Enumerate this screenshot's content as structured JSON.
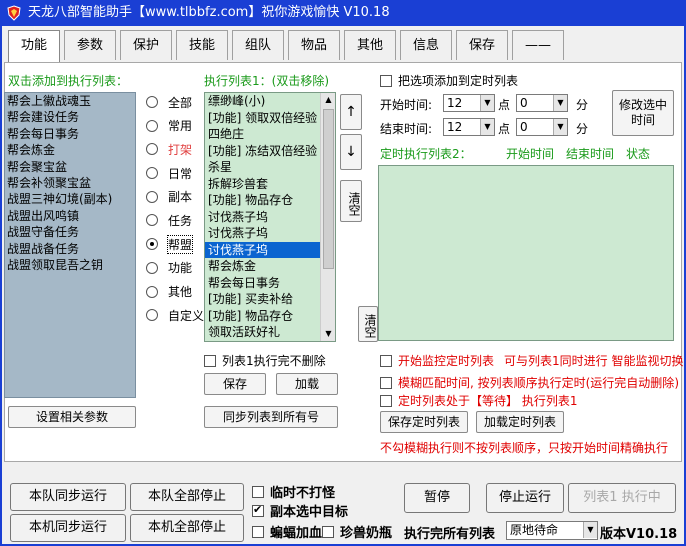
{
  "window": {
    "title": "天龙八部智能助手【www.tlbbfz.com】祝你游戏愉快 V10.18"
  },
  "tabs": [
    "功能",
    "参数",
    "保护",
    "技能",
    "组队",
    "物品",
    "其他",
    "信息",
    "保存",
    "——"
  ],
  "left_panel": {
    "header": "双击添加到执行列表：",
    "items": [
      "帮会上徽战魂玉",
      "帮会建设任务",
      "帮会每日事务",
      "帮会炼金",
      "帮会聚宝盆",
      "帮会补领聚宝盆",
      "战盟三神幻境(副本)",
      "战盟出风鸣镇",
      "战盟守备任务",
      "战盟战备任务",
      "战盟领取昆吾之钥"
    ],
    "settings_button": "设置相关参数"
  },
  "categories": {
    "items": [
      "全部",
      "常用",
      "打架",
      "日常",
      "副本",
      "任务",
      "帮盟",
      "功能",
      "其他",
      "自定义"
    ],
    "selected": "帮盟",
    "highlight": "打架"
  },
  "exec_list": {
    "header": "执行列表1：(双击移除)",
    "items": [
      "缥缈峰(小)",
      "[功能] 领取双倍经验",
      "四绝庄",
      "[功能] 冻结双倍经验",
      "杀星",
      "拆解珍兽套",
      "[功能] 物品存仓",
      "讨伐燕子坞",
      "讨伐燕子坞",
      "讨伐燕子坞",
      "帮会炼金",
      "帮会每日事务",
      "[功能] 买卖补给",
      "[功能] 物品存仓",
      "领取活跃好礼"
    ],
    "selected_index": 9,
    "up": "↑",
    "down": "↓",
    "clear": "清空",
    "no_delete_label": "列表1执行完不删除",
    "save": "保存",
    "load": "加载",
    "sync_all": "同步列表到所有号"
  },
  "timer": {
    "add_label": "把选项添加到定时列表",
    "start_label": "开始时间:",
    "end_label": "结束时间:",
    "start_hour": "12",
    "start_min": "0",
    "end_hour": "12",
    "end_min": "0",
    "hour_unit": "点",
    "min_unit": "分",
    "modify_button": "修改选中时间",
    "list_header": "定时执行列表2：",
    "col_start": "开始时间",
    "col_end": "结束时间",
    "col_status": "状态",
    "clear": "清空",
    "monitor_label": "开始监控定时列表",
    "monitor_note": "可与列表1同时进行 智能监视切换",
    "fuzzy_label": "模糊匹配时间, 按列表顺序执行定时(运行完自动删除)",
    "wait_label": "定时列表处于【等待】 执行列表1",
    "save": "保存定时列表",
    "load": "加载定时列表",
    "note": "不勾模糊执行则不按列表顺序，只按开始时间精确执行"
  },
  "bottom": {
    "team_sync_run": "本队同步运行",
    "team_stop_all": "本队全部停止",
    "local_sync_run": "本机同步运行",
    "local_stop_all": "本机全部停止",
    "no_fight": "临时不打怪",
    "copy_select": "副本选中目标",
    "bat_blood": "蝙蝠加血",
    "pet_milk": "珍兽奶瓶",
    "pause": "暂停",
    "stop": "停止运行",
    "list1_running": "列表1 执行中",
    "after_exec_label": "执行完所有列表",
    "after_exec_value": "原地待命",
    "version": "版本V10.18"
  }
}
